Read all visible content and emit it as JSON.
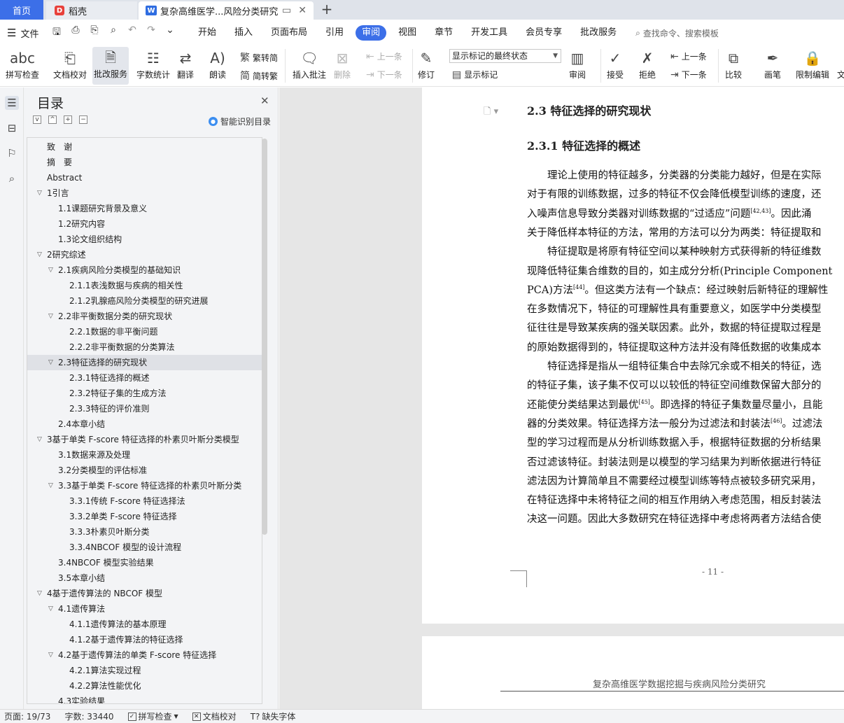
{
  "tabs": {
    "home": "首页",
    "daoke": "稻壳",
    "active_doc": "复杂高维医学...风险分类研究",
    "new_tab": "+"
  },
  "menu": {
    "file": "文件",
    "tabs": [
      "开始",
      "插入",
      "页面布局",
      "引用",
      "审阅",
      "视图",
      "章节",
      "开发工具",
      "会员专享",
      "批改服务"
    ],
    "active_tab": "审阅",
    "search_placeholder": "查找命令、搜索模板"
  },
  "ribbon": {
    "spell_check": "拼写检查",
    "doc_proof": "文档校对",
    "revise_service": "批改服务",
    "word_count": "字数统计",
    "translate": "翻译",
    "read_aloud": "朗读",
    "trad_simp": "繁转简",
    "simp_trad": "简转繁",
    "insert_comment": "插入批注",
    "delete": "删除",
    "prev": "上一条",
    "next": "下一条",
    "track_changes": "修订",
    "markup_state": "显示标记的最终状态",
    "show_markup": "显示标记",
    "review": "审阅",
    "accept": "接受",
    "reject": "拒绝",
    "prev2": "上一条",
    "next2": "下一条",
    "compare": "比较",
    "ink": "画笔",
    "restrict_edit": "限制编辑",
    "doc_cut": "文"
  },
  "toc": {
    "title": "目录",
    "smart": "智能识别目录",
    "items": [
      {
        "text": "致　谢",
        "level": 0,
        "arrow": ""
      },
      {
        "text": "摘　要",
        "level": 0,
        "arrow": ""
      },
      {
        "text": "Abstract",
        "level": 0,
        "arrow": ""
      },
      {
        "text": "1引言",
        "level": 0,
        "arrow": "v"
      },
      {
        "text": "1.1课题研究背景及意义",
        "level": 1,
        "arrow": ""
      },
      {
        "text": "1.2研究内容",
        "level": 1,
        "arrow": ""
      },
      {
        "text": "1.3论文组织结构",
        "level": 1,
        "arrow": ""
      },
      {
        "text": "2研究综述",
        "level": 0,
        "arrow": "v"
      },
      {
        "text": "2.1疾病风险分类模型的基础知识",
        "level": 1,
        "arrow": "v"
      },
      {
        "text": "2.1.1表浅数据与疾病的相关性",
        "level": 2,
        "arrow": ""
      },
      {
        "text": "2.1.2乳腺癌风险分类模型的研究进展",
        "level": 2,
        "arrow": ""
      },
      {
        "text": "2.2非平衡数据分类的研究现状",
        "level": 1,
        "arrow": "v"
      },
      {
        "text": "2.2.1数据的非平衡问题",
        "level": 2,
        "arrow": ""
      },
      {
        "text": "2.2.2非平衡数据的分类算法",
        "level": 2,
        "arrow": ""
      },
      {
        "text": "2.3特征选择的研究现状",
        "level": 1,
        "arrow": "v",
        "highlight": true
      },
      {
        "text": "2.3.1特征选择的概述",
        "level": 2,
        "arrow": ""
      },
      {
        "text": "2.3.2特征子集的生成方法",
        "level": 2,
        "arrow": ""
      },
      {
        "text": "2.3.3特征的评价准则",
        "level": 2,
        "arrow": ""
      },
      {
        "text": "2.4本章小结",
        "level": 1,
        "arrow": ""
      },
      {
        "text": "3基于单类 F-score 特征选择的朴素贝叶斯分类模型",
        "level": 0,
        "arrow": "v"
      },
      {
        "text": "3.1数据来源及处理",
        "level": 1,
        "arrow": ""
      },
      {
        "text": "3.2分类模型的评估标准",
        "level": 1,
        "arrow": ""
      },
      {
        "text": "3.3基于单类 F-score 特征选择的朴素贝叶斯分类",
        "level": 1,
        "arrow": "v"
      },
      {
        "text": "3.3.1传统 F-score 特征选择法",
        "level": 2,
        "arrow": ""
      },
      {
        "text": "3.3.2单类 F-score 特征选择",
        "level": 2,
        "arrow": ""
      },
      {
        "text": "3.3.3朴素贝叶斯分类",
        "level": 2,
        "arrow": ""
      },
      {
        "text": "3.3.4NBCOF 模型的设计流程",
        "level": 2,
        "arrow": ""
      },
      {
        "text": "3.4NBCOF 模型实验结果",
        "level": 1,
        "arrow": ""
      },
      {
        "text": "3.5本章小结",
        "level": 1,
        "arrow": ""
      },
      {
        "text": "4基于遗传算法的 NBCOF 模型",
        "level": 0,
        "arrow": "v"
      },
      {
        "text": "4.1遗传算法",
        "level": 1,
        "arrow": "v"
      },
      {
        "text": "4.1.1遗传算法的基本原理",
        "level": 2,
        "arrow": ""
      },
      {
        "text": "4.1.2基于遗传算法的特征选择",
        "level": 2,
        "arrow": ""
      },
      {
        "text": "4.2基于遗传算法的单类 F-score 特征选择",
        "level": 1,
        "arrow": "v"
      },
      {
        "text": "4.2.1算法实现过程",
        "level": 2,
        "arrow": ""
      },
      {
        "text": "4.2.2算法性能优化",
        "level": 2,
        "arrow": ""
      },
      {
        "text": "4.3实验结果",
        "level": 1,
        "arrow": ""
      }
    ]
  },
  "document": {
    "h2": "2.3  特征选择的研究现状",
    "h3": "2.3.1  特征选择的概述",
    "lines": [
      {
        "text": "　　理论上使用的特征越多，分类器的分类能力越好，但是在实际",
        "sup": "",
        "after": ""
      },
      {
        "text": "对于有限的训练数据，过多的特征不仅会降低模型训练的速度，还",
        "sup": "",
        "after": ""
      },
      {
        "text": "入噪声信息导致分类器对训练数据的“过适应”问题",
        "sup": "[42,43]",
        "after": "。因此涌"
      },
      {
        "text": "关于降低样本特征的方法，常用的方法可以分为两类：特征提取和",
        "sup": "",
        "after": ""
      },
      {
        "text": "　　特征提取是将原有特征空间以某种映射方式获得新的特征维数",
        "sup": "",
        "after": ""
      },
      {
        "text": "现降低特征集合维数的目的，如主成分分析(Principle Component",
        "sup": "",
        "after": ""
      },
      {
        "text": "PCA)方法",
        "sup": "[44]",
        "after": "。但这类方法有一个缺点：经过映射后新特征的理解性"
      },
      {
        "text": "在多数情况下，特征的可理解性具有重要意义，如医学中分类模型",
        "sup": "",
        "after": ""
      },
      {
        "text": "征往往是导致某疾病的强关联因素。此外，数据的特征提取过程是",
        "sup": "",
        "after": ""
      },
      {
        "text": "的原始数据得到的，特征提取这种方法并没有降低数据的收集成本",
        "sup": "",
        "after": ""
      },
      {
        "text": "　　特征选择是指从一组特征集合中去除冗余或不相关的特征，选",
        "sup": "",
        "after": ""
      },
      {
        "text": "的特征子集，该子集不仅可以以较低的特征空间维数保留大部分的",
        "sup": "",
        "after": ""
      },
      {
        "text": "还能使分类结果达到最优",
        "sup": "[45]",
        "after": "。即选择的特征子集数量尽量小，且能"
      },
      {
        "text": "器的分类效果。特征选择方法一般分为过滤法和封装法",
        "sup": "[46]",
        "after": "。过滤法"
      },
      {
        "text": "型的学习过程而是从分析训练数据入手，根据特征数据的分析结果",
        "sup": "",
        "after": ""
      },
      {
        "text": "否过滤该特征。封装法则是以模型的学习结果为判断依据进行特征",
        "sup": "",
        "after": ""
      },
      {
        "text": "滤法因为计算简单且不需要经过模型训练等特点被较多研究采用，",
        "sup": "",
        "after": ""
      },
      {
        "text": "在特征选择中未将特征之间的相互作用纳入考虑范围，相反封装法",
        "sup": "",
        "after": ""
      },
      {
        "text": "决这一问题。因此大多数研究在特征选择中考虑将两者方法结合使",
        "sup": "",
        "after": ""
      }
    ],
    "page_number": "- 11 -",
    "next_page_header": "复杂高维医学数据挖掘与疾病风险分类研究"
  },
  "status": {
    "page": "页面: 19/73",
    "words": "字数: 33440",
    "spell": "拼写检查",
    "proof": "文档校对",
    "missing_font": "缺失字体"
  }
}
